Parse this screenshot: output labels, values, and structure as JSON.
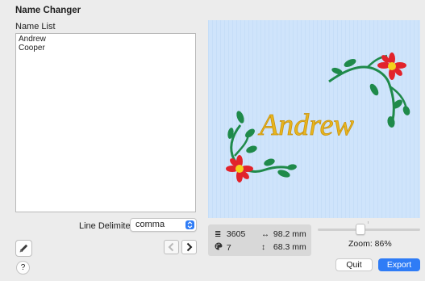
{
  "window": {
    "title": "Name Changer"
  },
  "name_list": {
    "label": "Name List",
    "names": [
      "Andrew",
      "Cooper"
    ]
  },
  "delimiter": {
    "label": "Line Delimiter:",
    "value": "comma"
  },
  "preview": {
    "design_text": "Andrew"
  },
  "stats": {
    "stitches": "3605",
    "width": "98.2 mm",
    "colors": "7",
    "height": "68.3 mm"
  },
  "zoom": {
    "label": "Zoom: 86%",
    "level": 0.86
  },
  "buttons": {
    "quit": "Quit",
    "export": "Export",
    "help": "?"
  },
  "colors": {
    "accent": "#2f7cf6",
    "preview_bg": "#cfe4fb",
    "thread_gold": "#e8b61e",
    "leaf_green": "#1f8a4a",
    "flower_red": "#e2232b"
  },
  "icons": {
    "edit": "pencil-icon",
    "prev": "chevron-left-icon",
    "next": "chevron-right-icon",
    "stitches": "stitch-lines-icon",
    "width": "horizontal-arrow-icon",
    "colors": "palette-icon",
    "height": "vertical-arrow-icon"
  }
}
